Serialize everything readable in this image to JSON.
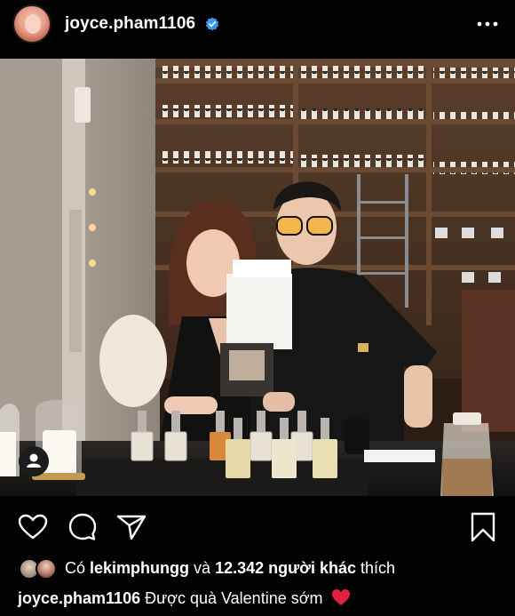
{
  "post": {
    "username": "joyce.pham1106",
    "verified": true,
    "more_icon": "more-horizontal-icon"
  },
  "actions": {
    "like_icon": "heart-outline-icon",
    "comment_icon": "comment-icon",
    "share_icon": "send-icon",
    "save_icon": "bookmark-icon"
  },
  "likes": {
    "prefix": "Có",
    "first_user": "lekimphungg",
    "connector": "và",
    "others_count": "12.342 người khác",
    "suffix": "thích"
  },
  "caption": {
    "username": "joyce.pham1106",
    "text": "Được quà Valentine sớm"
  },
  "colors": {
    "background": "#000000",
    "verified_badge": "#3897f0",
    "heart_emoji": "#e0223a"
  }
}
